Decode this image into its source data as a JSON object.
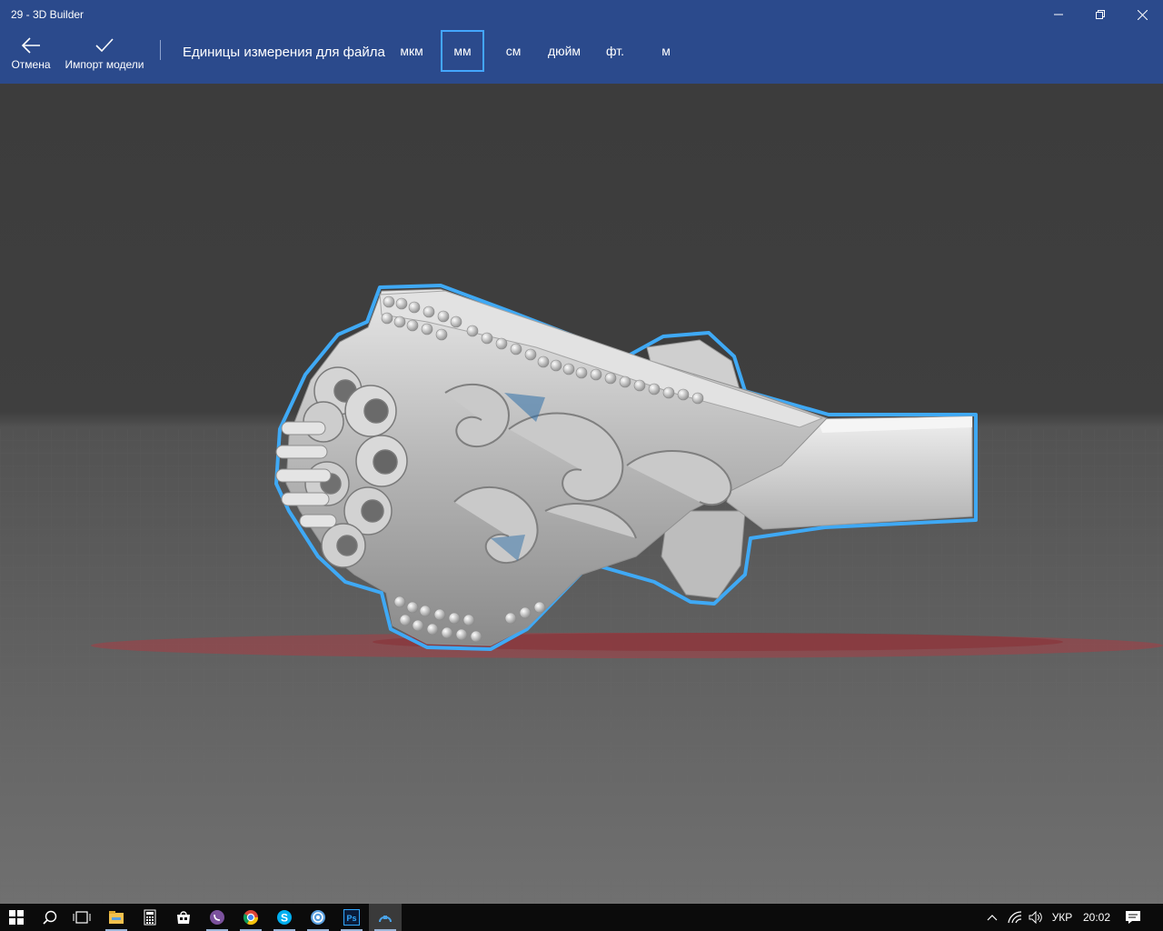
{
  "window": {
    "title": "29 - 3D Builder"
  },
  "commands": {
    "cancel_label": "Отмена",
    "import_label": "Импорт модели"
  },
  "units": {
    "label": "Единицы измерения для файла",
    "options": [
      "мкм",
      "мм",
      "см",
      "дюйм",
      "фт.",
      "м"
    ],
    "selected": "мм"
  },
  "colors": {
    "accent_bar": "#2b4a8c",
    "selection_outline": "#3fa9f5",
    "shadow": "#b8353d"
  },
  "taskbar": {
    "apps": [
      "start-icon",
      "search-icon",
      "task-view-icon",
      "file-explorer-icon",
      "calculator-icon",
      "store-icon",
      "viber-icon",
      "chrome-icon",
      "skype-icon",
      "app-icon",
      "photoshop-icon",
      "3d-builder-icon"
    ],
    "language": "УКР",
    "time": "20:02"
  }
}
